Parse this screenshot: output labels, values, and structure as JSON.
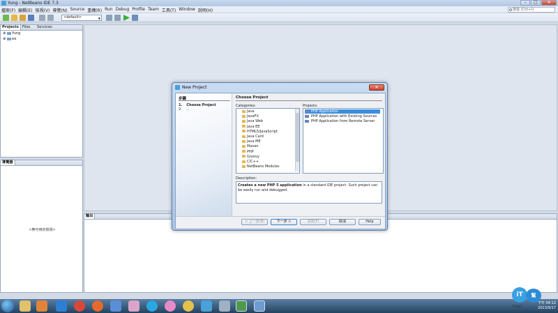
{
  "window": {
    "title": "Yung - NetBeans IDE 7.3"
  },
  "menu": {
    "items": [
      "檔案(F)",
      "編輯(E)",
      "檢視(V)",
      "導覽(N)",
      "Source",
      "重構(R)",
      "Run",
      "Debug",
      "Profile",
      "Team",
      "工具(T)",
      "Window",
      "說明(H)"
    ],
    "search_placeholder": "搜尋 (Ctrl+I)"
  },
  "toolbar": {
    "config_value": "<default>"
  },
  "projects_panel": {
    "tabs": [
      "Projects",
      "Files",
      "Services"
    ],
    "tree": [
      {
        "label": "Yung"
      },
      {
        "label": "ee"
      }
    ]
  },
  "navigator_panel": {
    "tab": "導覽器",
    "empty_text": "<無可用的檢視>"
  },
  "output_panel": {
    "tab": "輸出"
  },
  "dialog": {
    "title": "New Project",
    "steps_title": "步驟",
    "steps": [
      {
        "num": "1.",
        "label": "Choose Project"
      },
      {
        "num": "2.",
        "label": "..."
      }
    ],
    "content_title": "Choose Project",
    "categories_label": "Categories:",
    "projects_label": "Projects:",
    "categories": [
      "Java",
      "JavaFX",
      "Java Web",
      "Java EE",
      "HTML5/JavaScript",
      "Java Card",
      "Java ME",
      "Maven",
      "PHP",
      "Groovy",
      "C/C++",
      "NetBeans Modules"
    ],
    "projects": [
      {
        "label": "PHP Application",
        "selected": true
      },
      {
        "label": "PHP Application with Existing Sources",
        "selected": false
      },
      {
        "label": "PHP Application from Remote Server",
        "selected": false
      }
    ],
    "description_label": "Description:",
    "description_bold": "Creates a new PHP 5 application",
    "description_rest": " in a standard IDE project. Such project can be easily run and debugged.",
    "buttons": {
      "back": "< 上一步(B)",
      "next": "下一步 >",
      "finish": "完成(F)",
      "cancel": "取消",
      "help": "Help"
    }
  },
  "taskbar": {
    "time": "下午 04:12",
    "date": "2013/9/17"
  },
  "watermark": {
    "text": "iT邦幫忙"
  }
}
